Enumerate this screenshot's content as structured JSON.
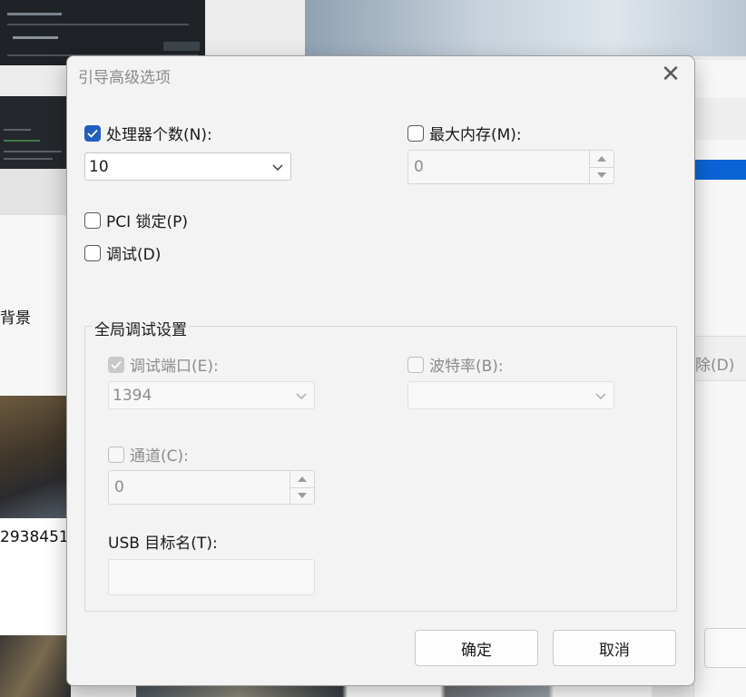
{
  "background": {
    "left_label": "背景",
    "left_number": "2938451",
    "right_label": "除(D)"
  },
  "dialog": {
    "title": "引导高级选项",
    "close_glyph": "✕",
    "processor_count": {
      "label": "处理器个数(N):",
      "checked": true,
      "value": "10"
    },
    "max_memory": {
      "label": "最大内存(M):",
      "checked": false,
      "value": "0"
    },
    "pci_lock": {
      "label": "PCI 锁定(P)",
      "checked": false
    },
    "debug": {
      "label": "调试(D)",
      "checked": false
    },
    "global_debug": {
      "group_label": "全局调试设置",
      "debug_port": {
        "label": "调试端口(E):",
        "checked": true,
        "disabled": true,
        "value": "1394"
      },
      "baud_rate": {
        "label": "波特率(B):",
        "checked": false,
        "disabled": true,
        "value": ""
      },
      "channel": {
        "label": "通道(C):",
        "checked": false,
        "disabled": true,
        "value": "0"
      },
      "usb_target": {
        "label": "USB 目标名(T):",
        "value": ""
      }
    },
    "buttons": {
      "ok": "确定",
      "cancel": "取消"
    }
  },
  "colors": {
    "accent": "#1f5fbf",
    "dialog_bg": "#f3f3f3",
    "disabled_text": "#8c8c8c"
  },
  "icons": [
    "close-icon",
    "checkmark-icon",
    "chevron-down-icon",
    "spin-up-icon",
    "spin-down-icon"
  ]
}
